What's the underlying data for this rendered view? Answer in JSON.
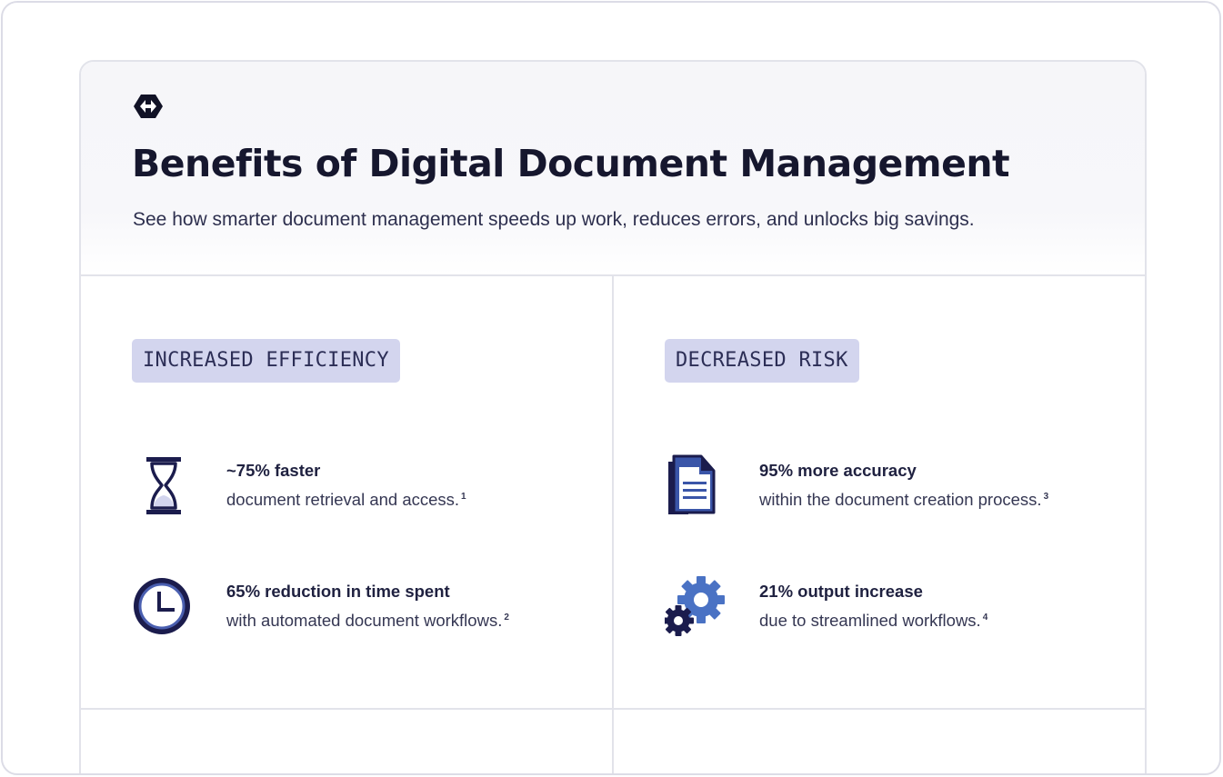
{
  "header": {
    "logo_icon": "diamond-arrows-logo-icon",
    "title": "Benefits of Digital Document Management",
    "subtitle": "See how smarter document management speeds up work, reduces errors, and unlocks big savings."
  },
  "sections": [
    {
      "tag": "INCREASED EFFICIENCY",
      "stats": [
        {
          "icon": "hourglass-icon",
          "headline": "~75% faster",
          "body": "document retrieval and access.",
          "footnote": "1"
        },
        {
          "icon": "clock-icon",
          "headline": "65% reduction in time spent",
          "body": "with automated document workflows.",
          "footnote": "2"
        }
      ]
    },
    {
      "tag": "DECREASED RISK",
      "stats": [
        {
          "icon": "document-icon",
          "headline": "95% more accuracy",
          "body": "within the document creation process.",
          "footnote": "3"
        },
        {
          "icon": "gears-icon",
          "headline": "21% output increase",
          "body": "due to streamlined workflows.",
          "footnote": "4"
        }
      ]
    }
  ],
  "colors": {
    "navy": "#1b1c4d",
    "accent_blue": "#3a55a8",
    "light_blue": "#4a72c4",
    "tag_bg": "#d3d5ee"
  }
}
